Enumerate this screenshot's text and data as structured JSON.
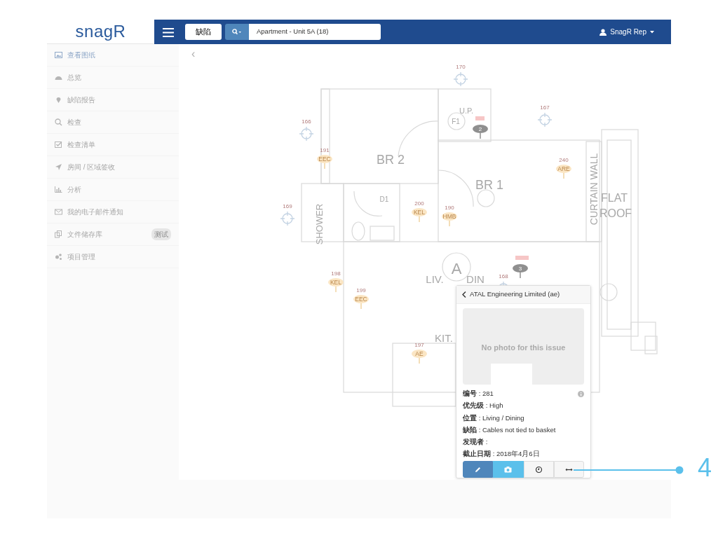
{
  "logo": {
    "text": "snagR"
  },
  "header": {
    "category": "缺陷",
    "location": "Apartment - Unit 5A (18)",
    "user": "SnagR Rep"
  },
  "sidebar": {
    "items": [
      {
        "label": "查看图纸",
        "selected": true
      },
      {
        "label": "总览",
        "selected": false
      },
      {
        "label": "缺陷报告",
        "selected": false
      },
      {
        "label": "检查",
        "selected": false
      },
      {
        "label": "检查清单",
        "selected": false
      },
      {
        "label": "房间 / 区域签收",
        "selected": false
      },
      {
        "label": "分析",
        "selected": false
      },
      {
        "label": "我的电子邮件通知",
        "selected": false
      },
      {
        "label": "文件储存库",
        "selected": false,
        "badge": "测试"
      },
      {
        "label": "项目管理",
        "selected": false
      }
    ]
  },
  "plan": {
    "back": "‹",
    "rooms": [
      "U.P.",
      "BR 2",
      "BR 1",
      "D1",
      "F1",
      "SHOWER",
      "CURTAIN WALL",
      "FLAT",
      "ROOF",
      "A",
      "LIV.",
      "DIN",
      "KIT."
    ],
    "pins": [
      {
        "kind": "target",
        "number": "170"
      },
      {
        "kind": "target",
        "number": "166"
      },
      {
        "kind": "target",
        "number": "167"
      },
      {
        "kind": "target",
        "number": "169"
      },
      {
        "kind": "target",
        "number": "168"
      },
      {
        "kind": "tag",
        "number": "191",
        "code": "EEC"
      },
      {
        "kind": "tag",
        "number": "240",
        "code": "ARE"
      },
      {
        "kind": "tag",
        "number": "200",
        "code": "KEL"
      },
      {
        "kind": "tag",
        "number": "190",
        "code": "HMB"
      },
      {
        "kind": "tag",
        "number": "198",
        "code": "KEL"
      },
      {
        "kind": "tag",
        "number": "199",
        "code": "EEC"
      },
      {
        "kind": "tag",
        "number": "197",
        "code": "AE"
      },
      {
        "kind": "bubble",
        "number": "2"
      },
      {
        "kind": "bubble",
        "number": "3"
      }
    ]
  },
  "popup": {
    "title": "ATAL Engineering Limited (ae)",
    "photo_text": "No photo for this issue",
    "fields": [
      {
        "label": "编号",
        "value": ": 281"
      },
      {
        "label": "优先级",
        "value": ": High"
      },
      {
        "label": "位置",
        "value": ": Living / Dining"
      },
      {
        "label": "缺陷",
        "value": ":  Cables not tied to basket"
      },
      {
        "label": "发现者",
        "value": ":"
      },
      {
        "label": "截止日期",
        "value": ": 2018年4月6日"
      }
    ],
    "buttons": [
      {
        "kind": "edit"
      },
      {
        "kind": "photo"
      },
      {
        "kind": "history"
      },
      {
        "kind": "move"
      }
    ]
  },
  "callout": {
    "label": "4"
  }
}
